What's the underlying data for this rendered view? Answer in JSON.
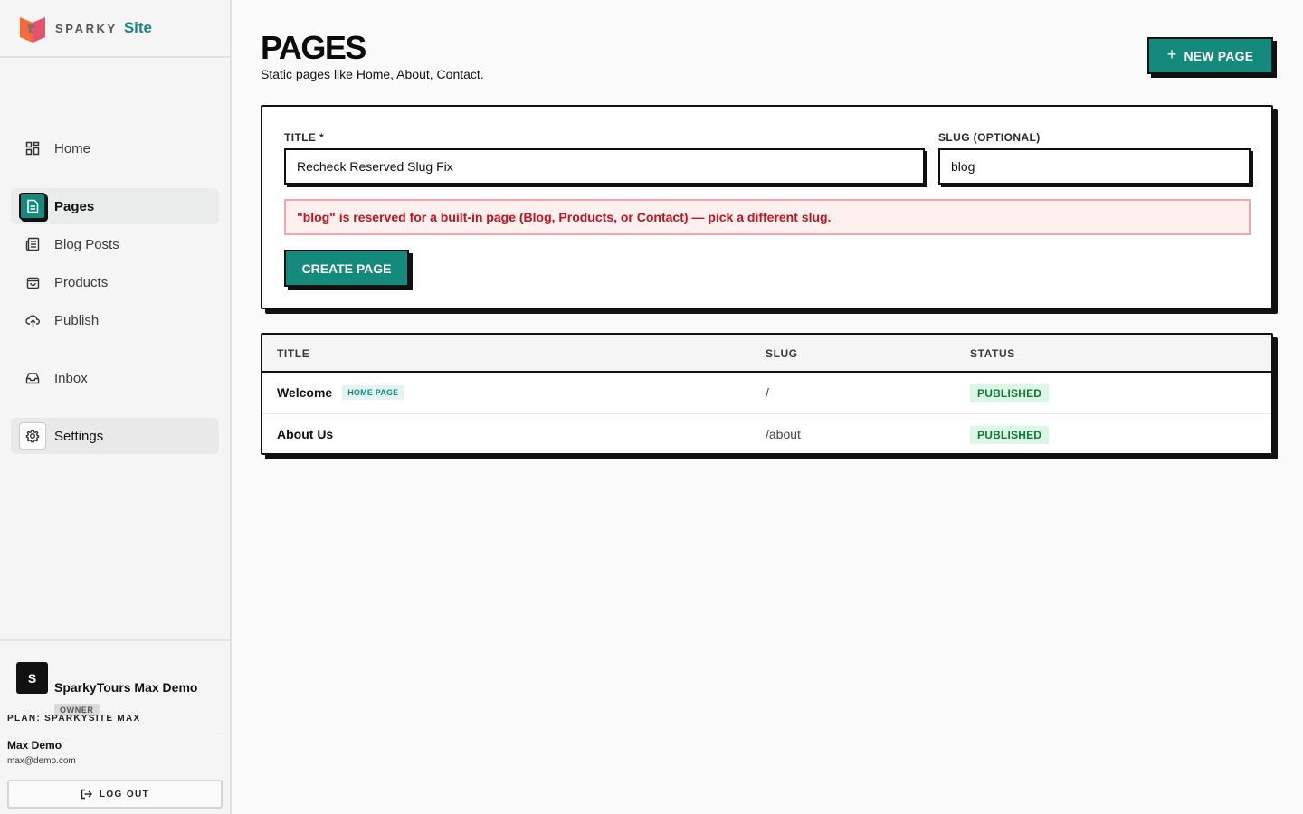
{
  "brand": {
    "name": "SPARKY",
    "site": "Site"
  },
  "sidebar": {
    "items": [
      {
        "label": "Home",
        "icon": "grid-icon"
      },
      {
        "label": "Pages",
        "icon": "document-icon",
        "active": true
      },
      {
        "label": "Blog Posts",
        "icon": "newspaper-icon"
      },
      {
        "label": "Products",
        "icon": "shopping-bag-icon"
      },
      {
        "label": "Publish",
        "icon": "cloud-upload-icon"
      },
      {
        "label": "Inbox",
        "icon": "inbox-icon"
      },
      {
        "label": "Settings",
        "icon": "gear-icon"
      }
    ]
  },
  "account": {
    "avatar_letter": "S",
    "site_name": "SparkyTours Max Demo",
    "role": "OWNER",
    "plan": "PLAN: SPARKYSITE MAX",
    "user_name": "Max Demo",
    "user_email": "max@demo.com",
    "logout_label": "LOG OUT"
  },
  "header": {
    "title": "PAGES",
    "subtitle": "Static pages like Home, About, Contact.",
    "new_page_label": "NEW PAGE"
  },
  "form": {
    "title_label": "TITLE *",
    "title_value": "Recheck Reserved Slug Fix",
    "slug_label": "SLUG (OPTIONAL)",
    "slug_value": "blog",
    "error": "\"blog\" is reserved for a built-in page (Blog, Products, or Contact) — pick a different slug.",
    "create_label": "CREATE PAGE"
  },
  "table": {
    "headers": [
      "TITLE",
      "SLUG",
      "STATUS"
    ],
    "rows": [
      {
        "title": "Welcome",
        "badge": "HOME PAGE",
        "slug": "/",
        "status": "PUBLISHED"
      },
      {
        "title": "About Us",
        "badge": "",
        "slug": "/about",
        "status": "PUBLISHED"
      }
    ]
  },
  "colors": {
    "accent": "#14897c",
    "error_text": "#c1121f",
    "error_bg": "#fff0f0",
    "published_text": "#0f7a36",
    "published_bg": "#dcf7e6"
  }
}
